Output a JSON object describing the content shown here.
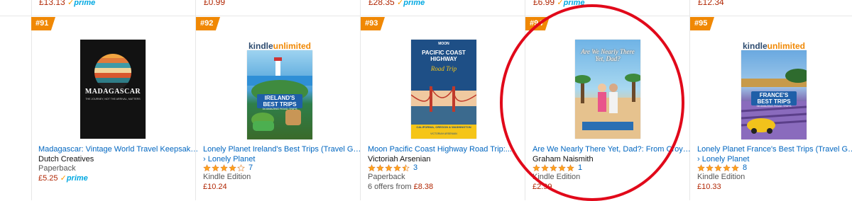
{
  "top_row": [
    {
      "price": "£13.13",
      "prime": true
    },
    {
      "price": "£0.99",
      "prime": false
    },
    {
      "price": "£28.35",
      "prime": true
    },
    {
      "price": "£6.99",
      "prime": true
    },
    {
      "price": "£12.34",
      "prime": false
    }
  ],
  "prime_label": "prime",
  "prime_check": "✓",
  "cards": [
    {
      "rank": "#91",
      "title": "Madagascar: Vintage World Travel Keepsake...",
      "author": "Dutch Creatives",
      "author_is_link": false,
      "format": "Paperback",
      "price": "£5.25",
      "prime": true,
      "cover_title": "MADAGASCAR",
      "cover_sub": "THE JOURNEY, NOT THE ARRIVAL, MATTERS"
    },
    {
      "rank": "#92",
      "kindle_unlimited": true,
      "ku_kindle": "kindle",
      "ku_unlimited": "unlimited",
      "title": "Lonely Planet Ireland's Best Trips (Travel Guide)",
      "author": "› Lonely Planet",
      "author_is_link": true,
      "rating": 4.0,
      "reviews": "7",
      "format": "Kindle Edition",
      "price": "£10.24",
      "cover_title": "IRELAND'S BEST TRIPS",
      "cover_sub": "34 AMAZING ROAD TRIPS"
    },
    {
      "rank": "#93",
      "title": "Moon Pacific Coast Highway Road Trip:...",
      "author": "Victoriah Arsenian",
      "author_is_link": false,
      "rating": 4.5,
      "reviews": "3",
      "format": "Paperback",
      "offers": "6 offers from",
      "price": "£8.38",
      "cover_brand": "MOON",
      "cover_title": "PACIFIC COAST HIGHWAY",
      "cover_script": "Road Trip",
      "cover_sub": "CALIFORNIA, OREGON & WASHINGTON",
      "cover_author": "VICTORIAH ARSENIAN"
    },
    {
      "rank": "#94",
      "title": "Are We Nearly There Yet, Dad?: From Croydon to...",
      "author": "Graham Naismith",
      "author_is_link": false,
      "rating": 5.0,
      "reviews": "1",
      "format": "Kindle Edition",
      "price": "£2.99",
      "cover_title": "Are We Nearly There Yet, Dad?"
    },
    {
      "rank": "#95",
      "kindle_unlimited": true,
      "ku_kindle": "kindle",
      "ku_unlimited": "unlimited",
      "title": "Lonely Planet France's Best Trips (Travel Guide)",
      "author": "› Lonely Planet",
      "author_is_link": true,
      "rating": 5.0,
      "reviews": "8",
      "format": "Kindle Edition",
      "price": "£10.33",
      "cover_title": "FRANCE'S BEST TRIPS",
      "cover_sub": "38 AMAZING ROAD TRIPS"
    }
  ],
  "colors": {
    "link": "#0066c0",
    "price": "#B12704",
    "badge": "#f08804",
    "star": "#ffa41c",
    "annotation": "#e1091a"
  }
}
